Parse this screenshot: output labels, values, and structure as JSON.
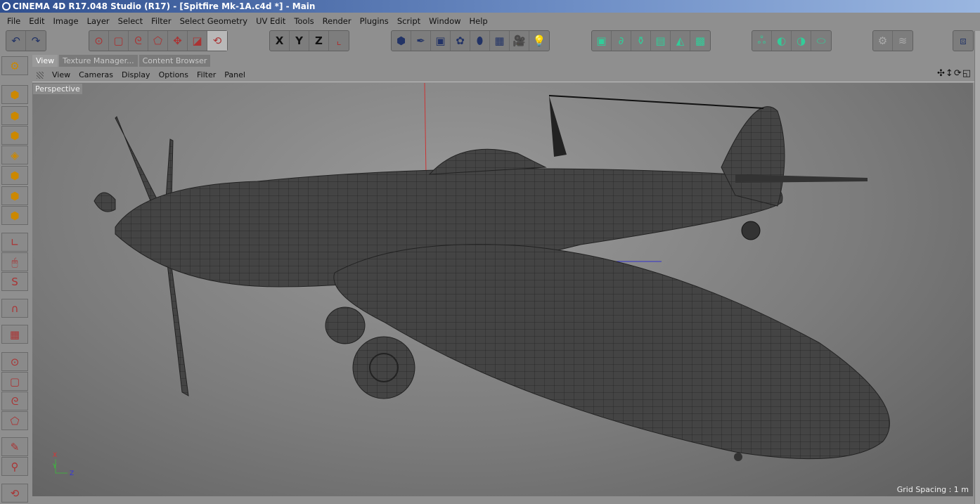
{
  "window": {
    "title": "CINEMA 4D R17.048 Studio (R17) - [Spitfire Mk-1A.c4d *] - Main"
  },
  "menu": [
    "File",
    "Edit",
    "Image",
    "Layer",
    "Select",
    "Filter",
    "Select Geometry",
    "UV Edit",
    "Tools",
    "Render",
    "Plugins",
    "Script",
    "Window",
    "Help"
  ],
  "toolbar": {
    "history": [
      {
        "icon": "undo-icon",
        "g": "↶"
      },
      {
        "icon": "redo-icon",
        "g": "↷"
      }
    ],
    "tools": [
      {
        "icon": "live-select-icon",
        "g": "⊙"
      },
      {
        "icon": "rectangle-select-icon",
        "g": "▢"
      },
      {
        "icon": "lasso-select-icon",
        "g": "ᘓ"
      },
      {
        "icon": "polygon-select-icon",
        "g": "⬠"
      },
      {
        "icon": "move-icon",
        "g": "✥"
      },
      {
        "icon": "scale-icon",
        "g": "◪"
      },
      {
        "icon": "rotate-icon",
        "g": "⟲"
      }
    ],
    "axes": [
      {
        "icon": "x-axis-icon",
        "g": "X"
      },
      {
        "icon": "y-axis-icon",
        "g": "Y"
      },
      {
        "icon": "z-axis-icon",
        "g": "Z"
      },
      {
        "icon": "coordinate-system-icon",
        "g": "⌞"
      }
    ],
    "objects": [
      {
        "icon": "cube-icon",
        "g": "⬢"
      },
      {
        "icon": "pen-icon",
        "g": "✒"
      },
      {
        "icon": "subdivision-icon",
        "g": "▣"
      },
      {
        "icon": "cloner-icon",
        "g": "✿"
      },
      {
        "icon": "deformer-icon",
        "g": "⬮"
      },
      {
        "icon": "floor-icon",
        "g": "▦"
      },
      {
        "icon": "camera-icon",
        "g": "🎥"
      },
      {
        "icon": "light-icon",
        "g": "💡"
      }
    ],
    "generators": [
      {
        "icon": "extrude-icon",
        "g": "▣"
      },
      {
        "icon": "sweep-icon",
        "g": "∂"
      },
      {
        "icon": "lathe-icon",
        "g": "⚱"
      },
      {
        "icon": "loft-icon",
        "g": "▤"
      },
      {
        "icon": "bend-icon",
        "g": "◭"
      },
      {
        "icon": "bezier-icon",
        "g": "▩"
      }
    ],
    "modeling": [
      {
        "icon": "metaball-icon",
        "g": "ஃ"
      },
      {
        "icon": "boole-icon",
        "g": "◐"
      },
      {
        "icon": "symmetry-icon",
        "g": "◑"
      },
      {
        "icon": "instance-icon",
        "g": "⬭"
      }
    ],
    "disabled": [
      {
        "icon": "dynamics-icon",
        "g": "⚙"
      },
      {
        "icon": "hair-icon",
        "g": "≋"
      }
    ],
    "layout": [
      {
        "icon": "layout-icon",
        "g": "⧈"
      }
    ]
  },
  "tabs": [
    {
      "label": "View",
      "active": true
    },
    {
      "label": "Texture Manager..."
    },
    {
      "label": "Content Browser"
    }
  ],
  "viewport": {
    "menu": [
      "View",
      "Cameras",
      "Display",
      "Options",
      "Filter",
      "Panel"
    ],
    "camera_label": "Perspective",
    "grid_spacing": "Grid Spacing : 1 m",
    "nav": "✣↕⟳◱",
    "axis": {
      "x": "X",
      "y": "Y",
      "z": "Z"
    }
  },
  "left_tools": [
    {
      "icon": "make-editable-icon",
      "g": "⚙"
    },
    {
      "icon": "model-mode-icon",
      "g": "⬢"
    },
    {
      "icon": "object-mode-icon",
      "g": "⬢"
    },
    {
      "icon": "texture-mode-icon",
      "g": "⬢"
    },
    {
      "icon": "workplane-icon",
      "g": "◈"
    },
    {
      "icon": "points-mode-icon",
      "g": "⬢"
    },
    {
      "icon": "edges-mode-icon",
      "g": "⬢"
    },
    {
      "icon": "polygons-mode-icon",
      "g": "⬢"
    },
    {
      "icon": "axis-mode-icon",
      "g": "∟"
    },
    {
      "icon": "tweak-mode-icon",
      "g": "🖱"
    },
    {
      "icon": "solo-icon",
      "g": "S"
    },
    {
      "icon": "snap-icon",
      "g": "∩"
    },
    {
      "icon": "lock-workplane-icon",
      "g": "▦"
    },
    {
      "icon": "live-select-icon",
      "g": "⊙"
    },
    {
      "icon": "rectangle-select-icon",
      "g": "▢"
    },
    {
      "icon": "lasso-select-icon",
      "g": "ᘓ"
    },
    {
      "icon": "polygon-select-icon",
      "g": "⬠"
    },
    {
      "icon": "brush-icon",
      "g": "✎"
    },
    {
      "icon": "eyedropper-icon",
      "g": "⚲"
    },
    {
      "icon": "rotate-icon",
      "g": "⟲"
    }
  ],
  "colors": {
    "accent": "#e07030",
    "mesh": "#3a3a3a"
  }
}
